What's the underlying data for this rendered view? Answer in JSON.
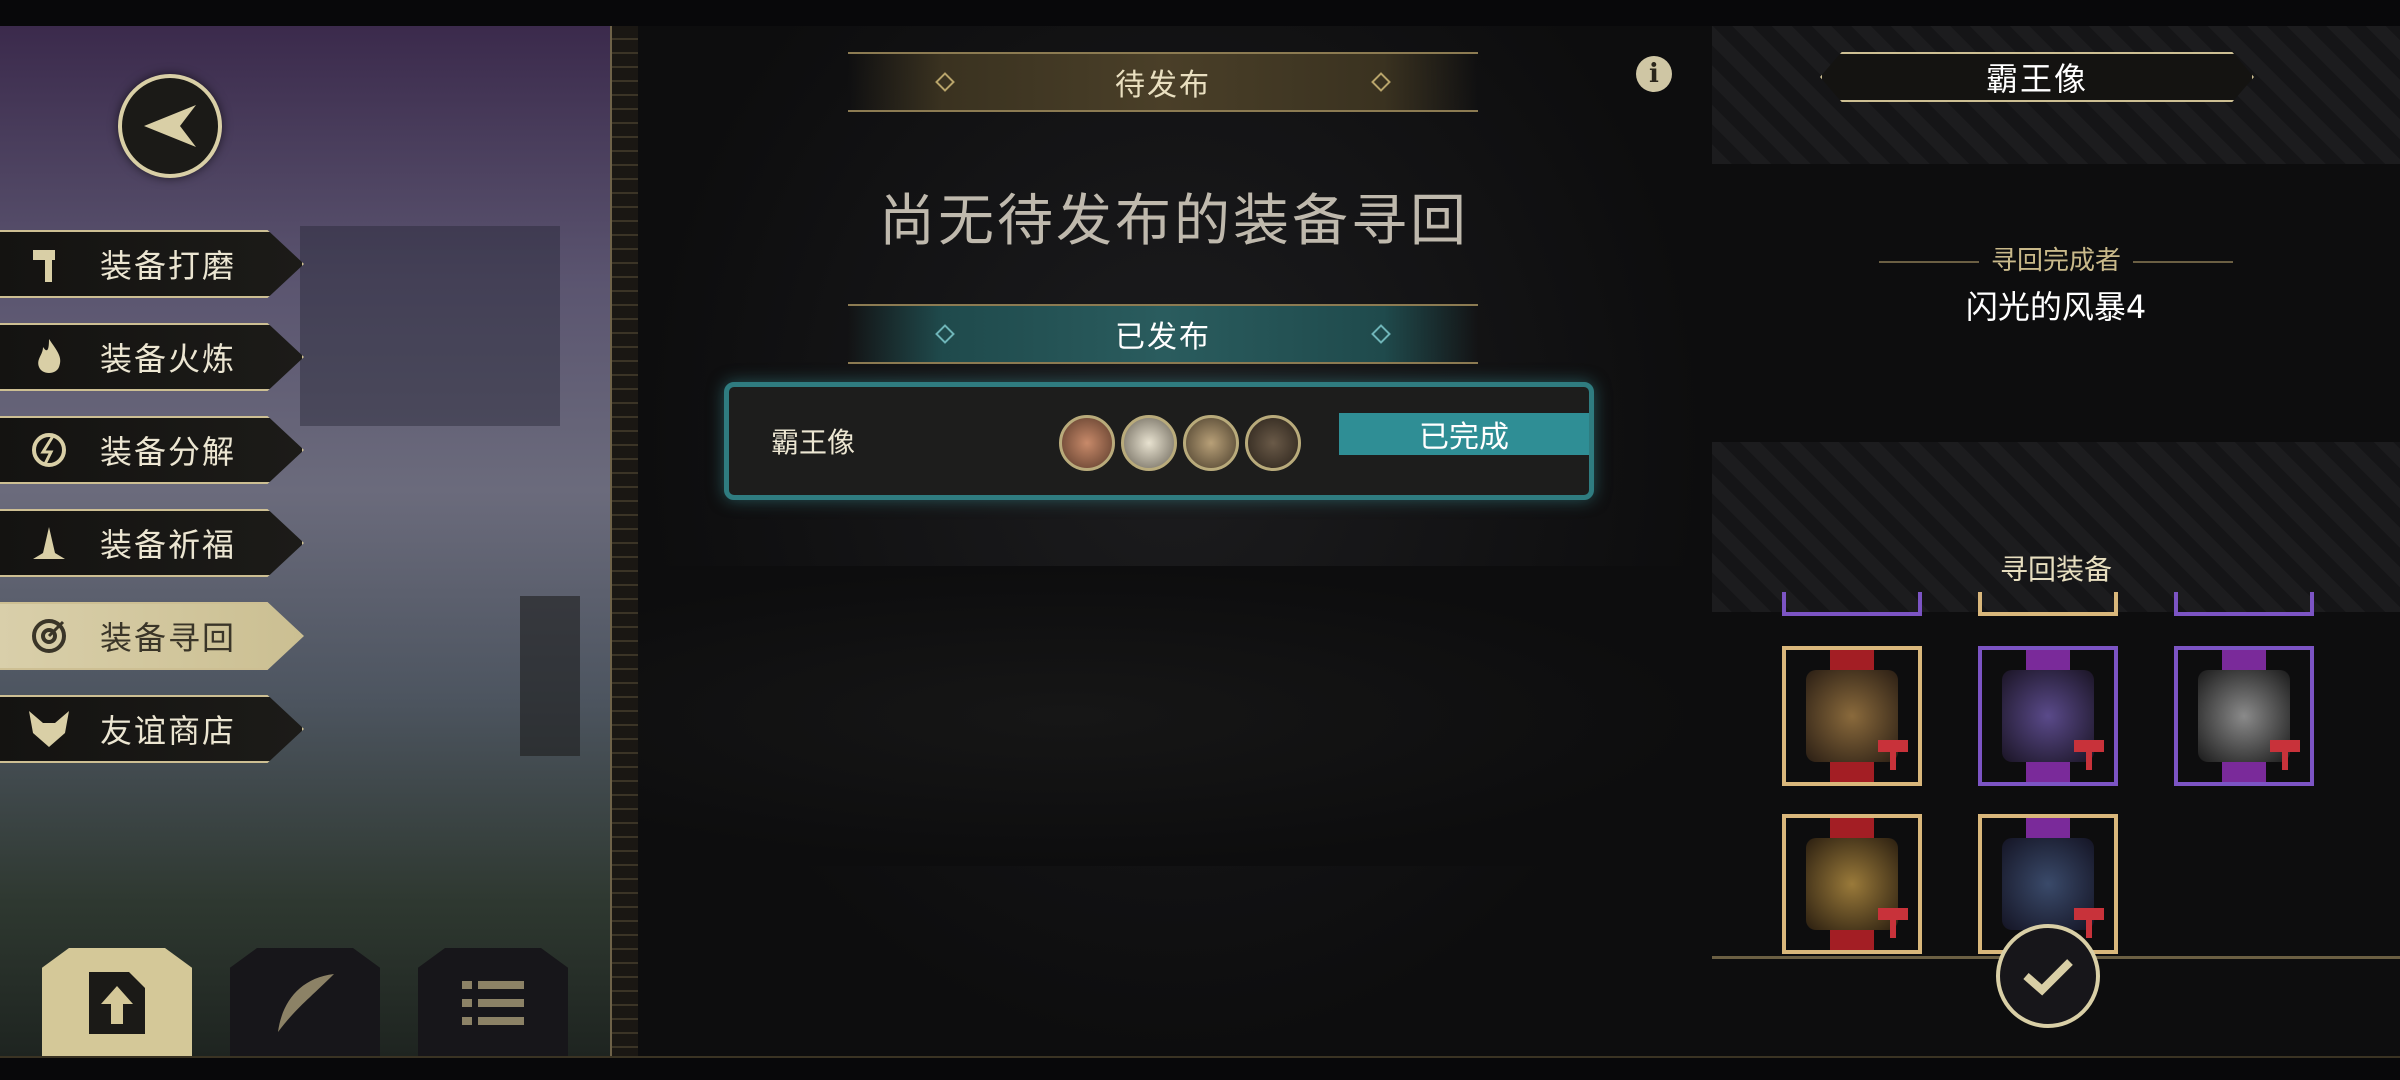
{
  "left_menu": {
    "items": [
      {
        "label": "装备打磨",
        "icon": "hammer-icon"
      },
      {
        "label": "装备火炼",
        "icon": "flame-icon"
      },
      {
        "label": "装备分解",
        "icon": "decompose-icon"
      },
      {
        "label": "装备祈福",
        "icon": "pray-hands-icon"
      },
      {
        "label": "装备寻回",
        "icon": "target-icon",
        "active": true
      },
      {
        "label": "友谊商店",
        "icon": "fox-icon"
      }
    ],
    "bottom_tabs": [
      "upload-icon",
      "feather-icon",
      "list-icon"
    ]
  },
  "center": {
    "pending_header": "待发布",
    "empty_message": "尚无待发布的装备寻回",
    "published_header": "已发布",
    "quests": [
      {
        "name": "霸王像",
        "status": "已完成"
      }
    ]
  },
  "right": {
    "title": "霸王像",
    "completer_label": "寻回完成者",
    "completer_name": "闪光的风暴4",
    "equipment_label": "寻回装备"
  },
  "colors": {
    "gold": "#cdbf93",
    "teal": "#2f8e95",
    "purple": "#7c54c4",
    "red": "#c8323a"
  }
}
